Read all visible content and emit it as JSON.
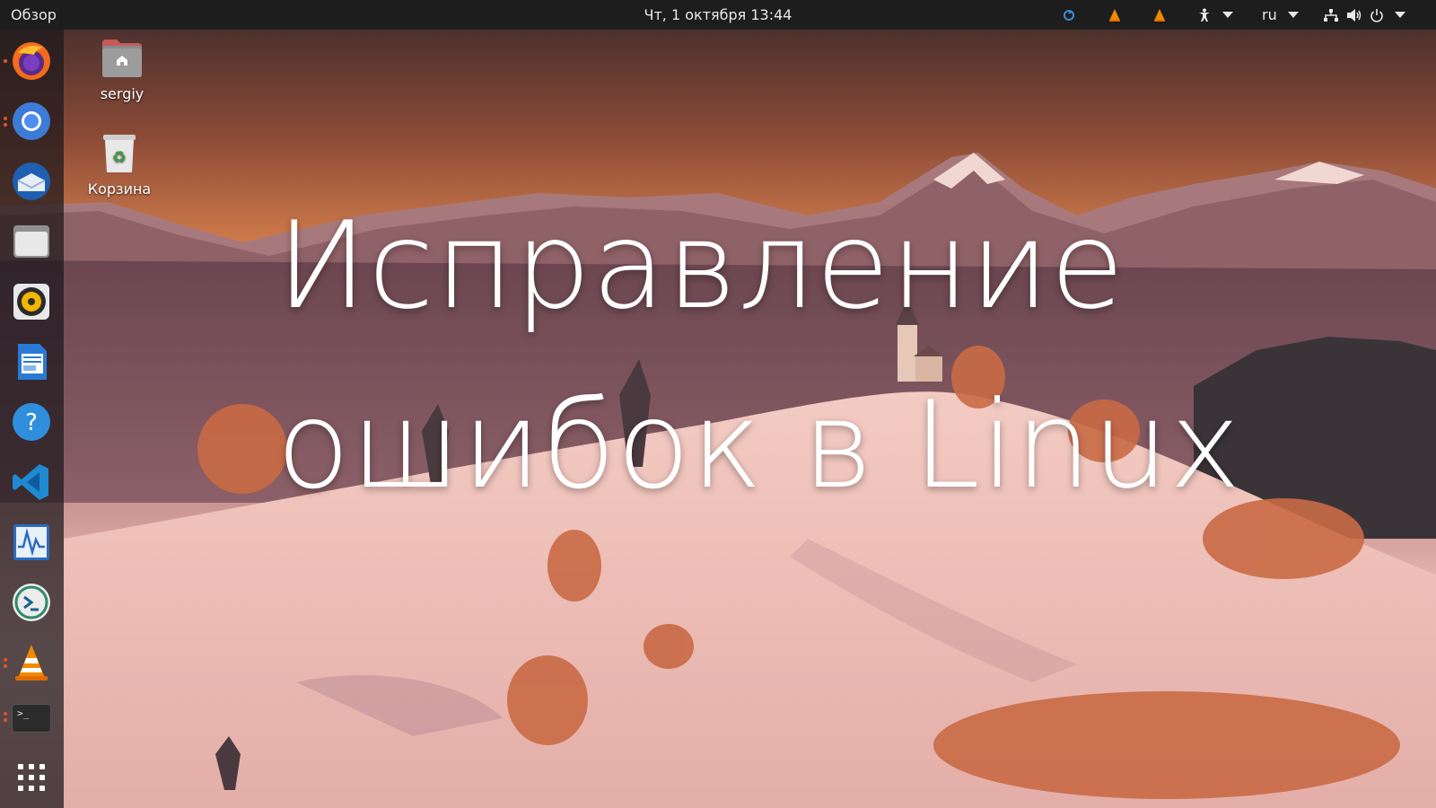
{
  "topbar": {
    "activities_label": "Обзор",
    "clock": "Чт, 1 октября  13:44",
    "keyboard_layout": "ru",
    "tray_icons": [
      "update-icon",
      "vlc-tray-icon",
      "vlc-tray-icon-2",
      "accessibility-icon",
      "network-icon",
      "volume-icon",
      "power-icon"
    ]
  },
  "dock": {
    "apps": [
      {
        "name": "firefox",
        "icon": "firefox-icon",
        "running": true
      },
      {
        "name": "chromium",
        "icon": "chromium-icon",
        "running": true
      },
      {
        "name": "thunderbird",
        "icon": "thunderbird-icon",
        "running": false
      },
      {
        "name": "files",
        "icon": "files-icon",
        "running": false
      },
      {
        "name": "rhythmbox",
        "icon": "rhythmbox-icon",
        "running": false
      },
      {
        "name": "libreoffice-writer",
        "icon": "writer-icon",
        "running": false
      },
      {
        "name": "help",
        "icon": "help-icon",
        "running": false
      },
      {
        "name": "vscode",
        "icon": "vscode-icon",
        "running": false
      },
      {
        "name": "system-monitor",
        "icon": "system-monitor-icon",
        "running": false
      },
      {
        "name": "remote-desktop",
        "icon": "remote-desktop-icon",
        "running": false
      },
      {
        "name": "vlc",
        "icon": "vlc-icon",
        "running": true
      },
      {
        "name": "terminal",
        "icon": "terminal-icon",
        "running": true
      }
    ],
    "show_apps_icon": "app-grid-icon",
    "terminal_prompt": ">_"
  },
  "desktop": {
    "icons": [
      {
        "label": "sergiy",
        "icon": "home-folder-icon"
      },
      {
        "label": "Корзина",
        "icon": "trash-icon"
      }
    ]
  },
  "headline": {
    "line1": "Исправление",
    "line2": "ошибок в Linux"
  },
  "colors": {
    "topbar": "#1d1d1d",
    "accent": "#e95420",
    "text": "#ffffff"
  }
}
